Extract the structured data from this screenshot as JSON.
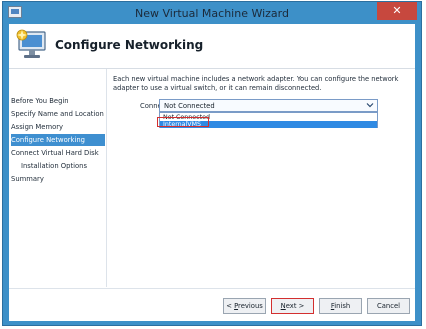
{
  "window": {
    "title": "New Virtual Machine Wizard",
    "close_glyph": "✕"
  },
  "header": {
    "page_title": "Configure Networking"
  },
  "nav": {
    "items": [
      {
        "label": "Before You Begin"
      },
      {
        "label": "Specify Name and Location"
      },
      {
        "label": "Assign Memory"
      },
      {
        "label": "Configure Networking",
        "active": true
      },
      {
        "label": "Connect Virtual Hard Disk"
      },
      {
        "label": "Installation Options",
        "indent": true
      },
      {
        "label": "Summary"
      }
    ]
  },
  "main": {
    "description": "Each new virtual machine includes a network adapter. You can configure the network adapter to use a virtual switch, or it can remain disconnected.",
    "connection_label": "Connection:",
    "connection_value": "Not Connected",
    "dropdown_options": [
      "Not Connected",
      "InternalVMS"
    ],
    "highlighted_option": "InternalVMS"
  },
  "buttons": {
    "previous": {
      "arrow": "< ",
      "mnemonic": "P",
      "rest": "revious"
    },
    "next": {
      "mnemonic": "N",
      "rest": "ext >"
    },
    "finish": {
      "mnemonic": "F",
      "rest": "inish"
    },
    "cancel": {
      "label": "Cancel"
    }
  },
  "colors": {
    "frame": "#3d90c8",
    "nav_active_bg": "#3e8fd0",
    "dropdown_selected_bg": "#2f8ae3",
    "annotation_red": "#d32f2f"
  }
}
